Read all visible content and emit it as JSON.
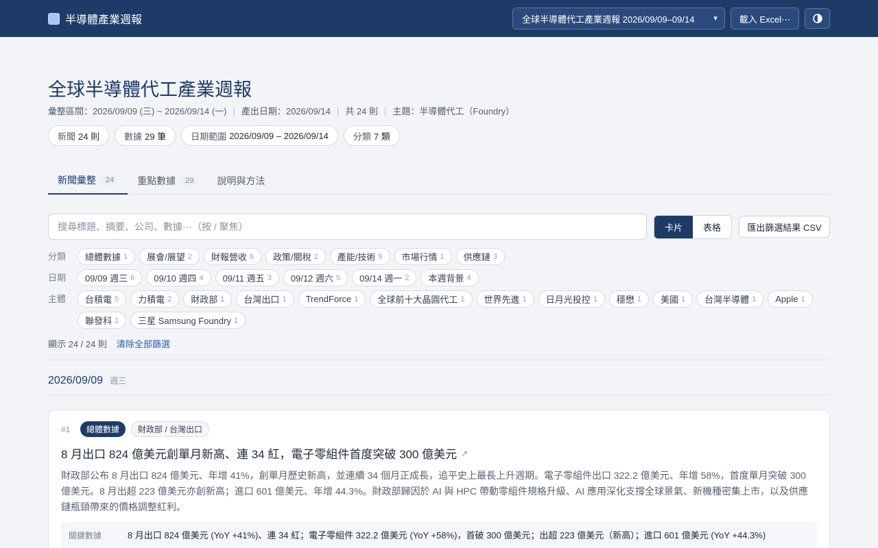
{
  "brand": {
    "title": "半導體產業週報"
  },
  "header": {
    "report_selected": "全球半導體代工產業週報 2026/09/09–09/14",
    "excel_button": "載入 Excel⋯"
  },
  "page": {
    "title": "全球半導體代工產業週報",
    "meta": [
      "彙整區間：2026/09/09 (三) ~ 2026/09/14 (一)",
      "產出日期：2026/09/14",
      "共 24 則",
      "主題：半導體代工（Foundry）"
    ],
    "stats": [
      {
        "label": "新聞",
        "value": "24 則"
      },
      {
        "label": "數據",
        "value": "29 筆"
      },
      {
        "label": "日期範圍",
        "value": "2026/09/09 – 2026/09/14"
      },
      {
        "label": "分類",
        "value": "7 類"
      }
    ]
  },
  "tabs": [
    {
      "label": "新聞彙整",
      "count": "24",
      "active": true
    },
    {
      "label": "重點數據",
      "count": "29",
      "active": false
    },
    {
      "label": "說明與方法",
      "count": "",
      "active": false
    }
  ],
  "toolbar": {
    "search_placeholder": "搜尋標題、摘要、公司、數據⋯（按 / 聚焦）",
    "view_card": "卡片",
    "view_table": "表格",
    "export_csv": "匯出篩選結果 CSV"
  },
  "filters": {
    "category": {
      "label": "分類",
      "chips": [
        {
          "label": "總體數據",
          "count": "1"
        },
        {
          "label": "展會/展望",
          "count": "2"
        },
        {
          "label": "財報營收",
          "count": "6"
        },
        {
          "label": "政策/關稅",
          "count": "2"
        },
        {
          "label": "產能/技術",
          "count": "9"
        },
        {
          "label": "市場行情",
          "count": "1"
        },
        {
          "label": "供應鏈",
          "count": "3"
        }
      ]
    },
    "date": {
      "label": "日期",
      "chips": [
        {
          "label": "09/09 週三",
          "count": "6"
        },
        {
          "label": "09/10 週四",
          "count": "4"
        },
        {
          "label": "09/11 週五",
          "count": "3"
        },
        {
          "label": "09/12 週六",
          "count": "5"
        },
        {
          "label": "09/14 週一",
          "count": "2"
        },
        {
          "label": "本週背景",
          "count": "4"
        }
      ]
    },
    "entity": {
      "label": "主體",
      "chips": [
        {
          "label": "台積電",
          "count": "5"
        },
        {
          "label": "力積電",
          "count": "2"
        },
        {
          "label": "財政部",
          "count": "1"
        },
        {
          "label": "台灣出口",
          "count": "1"
        },
        {
          "label": "TrendForce",
          "count": "1"
        },
        {
          "label": "全球前十大晶圓代工",
          "count": "1"
        },
        {
          "label": "世界先進",
          "count": "1"
        },
        {
          "label": "日月光投控",
          "count": "1"
        },
        {
          "label": "穩懋",
          "count": "1"
        },
        {
          "label": "美國",
          "count": "1"
        },
        {
          "label": "台灣半導體",
          "count": "1"
        },
        {
          "label": "Apple",
          "count": "1"
        },
        {
          "label": "聯發科",
          "count": "1"
        },
        {
          "label": "三星 Samsung Foundry",
          "count": "1"
        }
      ]
    }
  },
  "results": {
    "summary": "顯示 24 / 24 則",
    "clear": "清除全部篩選"
  },
  "date_group": {
    "date": "2026/09/09",
    "weekday": "週三"
  },
  "card": {
    "num": "#1",
    "category": "總體數據",
    "entities": "財政部 / 台灣出口",
    "title": "8 月出口 824 億美元創單月新高、連 34 紅，電子零組件首度突破 300 億美元",
    "summary": "財政部公布 8 月出口 824 億美元、年增 41%，創單月歷史新高，並連續 34 個月正成長，追平史上最長上升週期。電子零組件出口 322.2 億美元、年增 58%，首度單月突破 300 億美元。8 月出超 223 億美元亦創新高；進口 601 億美元、年增 44.3%。財政部歸因於 AI 與 HPC 帶動零組件規格升級、AI 應用深化支撐全球景氣、新機種密集上市，以及供應鏈瓶頸帶來的價格調整紅利。",
    "key_label": "關鍵數據",
    "key_value": "8 月出口 824 億美元 (YoY +41%)、連 34 紅；電子零組件 322.2 億美元 (YoY +58%)，首破 300 億美元；出超 223 億美元（新高）；進口 601 億美元 (YoY +44.3%)"
  }
}
